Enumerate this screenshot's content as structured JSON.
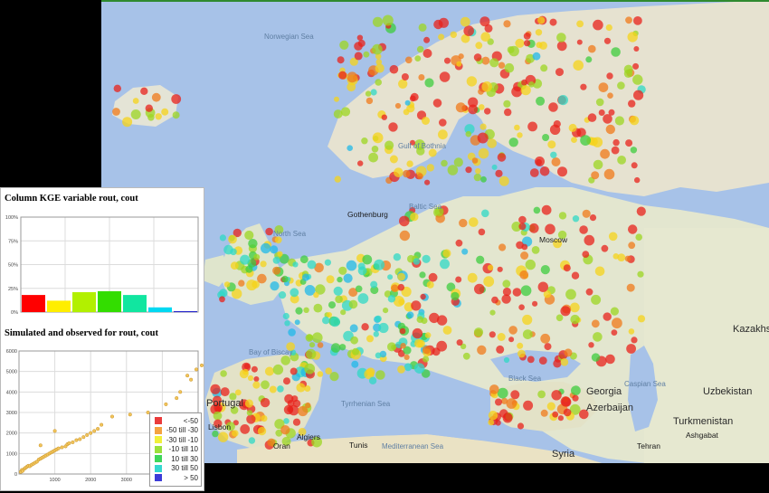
{
  "map": {
    "labels": {
      "seas": [
        "Norwegian Sea",
        "North Sea",
        "Baltic Sea",
        "Gulf of Bothnia",
        "Bay of Biscay",
        "Black Sea",
        "Caspian Sea",
        "Tyrrhenian Sea",
        "Mediterranean Sea"
      ],
      "countries": [
        "Kazakhs",
        "Uzbekistan",
        "Turkmenistan",
        "Azerbaijan",
        "Georgia",
        "Syria",
        "Portugal"
      ],
      "cities": [
        "Moscow",
        "Algiers",
        "Tunis",
        "Oran",
        "Tehran",
        "Ashgabat",
        "Lisbon",
        "Gothenburg"
      ]
    },
    "marker_colors": [
      "#e8221b",
      "#f07a1a",
      "#f5d31a",
      "#9cd622",
      "#3ecc3e",
      "#2fd8c6",
      "#20b8e8"
    ]
  },
  "kge_chart": {
    "title": "Column KGE variable rout, cout",
    "yticks": [
      "100%",
      "75%",
      "50%",
      "25%",
      "0%"
    ]
  },
  "scatter_chart": {
    "title": "Simulated and observed for rout, cout",
    "yticks": [
      "6000",
      "5000",
      "4000",
      "3000",
      "2000",
      "1000",
      "0"
    ],
    "xticks": [
      "1000",
      "2000",
      "3000",
      "4000"
    ]
  },
  "legend": {
    "items": [
      {
        "label": "<-50",
        "color": "#ea3b3b"
      },
      {
        "label": "-50 till -30",
        "color": "#f4a340"
      },
      {
        "label": "-30 till -10",
        "color": "#f0f03a"
      },
      {
        "label": "-10 till 10",
        "color": "#9be03b"
      },
      {
        "label": "10 till 30",
        "color": "#3ed65a"
      },
      {
        "label": "30 till 50",
        "color": "#34d8cf"
      },
      {
        "label": "> 50",
        "color": "#3c3cd8"
      }
    ]
  },
  "chart_data": [
    {
      "type": "bar",
      "title": "Column KGE variable rout, cout",
      "categories": [
        "<-50",
        "-50 till -30",
        "-30 till -10",
        "-10 till 10",
        "10 till 30",
        "30 till 50",
        "> 50"
      ],
      "values": [
        18,
        12,
        21,
        22,
        18,
        5,
        1
      ],
      "colors": [
        "#ff0000",
        "#ffee00",
        "#b2f000",
        "#33dd00",
        "#11e6a0",
        "#00d8f2",
        "#2222cc"
      ],
      "ylim": [
        0,
        100
      ],
      "grid": true
    },
    {
      "type": "scatter",
      "title": "Simulated and observed for rout, cout",
      "xlim": [
        0,
        5000
      ],
      "ylim": [
        0,
        6000
      ],
      "grid": true,
      "points": [
        [
          50,
          100
        ],
        [
          80,
          200
        ],
        [
          100,
          150
        ],
        [
          150,
          250
        ],
        [
          180,
          300
        ],
        [
          220,
          350
        ],
        [
          260,
          400
        ],
        [
          300,
          380
        ],
        [
          350,
          450
        ],
        [
          400,
          500
        ],
        [
          450,
          550
        ],
        [
          500,
          600
        ],
        [
          550,
          700
        ],
        [
          600,
          750
        ],
        [
          650,
          800
        ],
        [
          700,
          850
        ],
        [
          750,
          900
        ],
        [
          800,
          950
        ],
        [
          850,
          1000
        ],
        [
          900,
          1050
        ],
        [
          950,
          1100
        ],
        [
          1000,
          1150
        ],
        [
          1050,
          1200
        ],
        [
          1100,
          1250
        ],
        [
          1200,
          1300
        ],
        [
          1300,
          1350
        ],
        [
          1350,
          1450
        ],
        [
          1400,
          1500
        ],
        [
          1500,
          1550
        ],
        [
          1600,
          1650
        ],
        [
          1700,
          1700
        ],
        [
          1800,
          1800
        ],
        [
          1900,
          1900
        ],
        [
          600,
          1400
        ],
        [
          1000,
          2100
        ],
        [
          2000,
          2000
        ],
        [
          2100,
          2100
        ],
        [
          2200,
          2200
        ],
        [
          2300,
          2400
        ],
        [
          2600,
          2800
        ],
        [
          3100,
          2900
        ],
        [
          3600,
          3000
        ],
        [
          4100,
          3400
        ],
        [
          4400,
          3700
        ],
        [
          4500,
          4000
        ],
        [
          4800,
          4600
        ],
        [
          4700,
          4800
        ],
        [
          4950,
          5100
        ],
        [
          5100,
          5300
        ]
      ]
    }
  ]
}
